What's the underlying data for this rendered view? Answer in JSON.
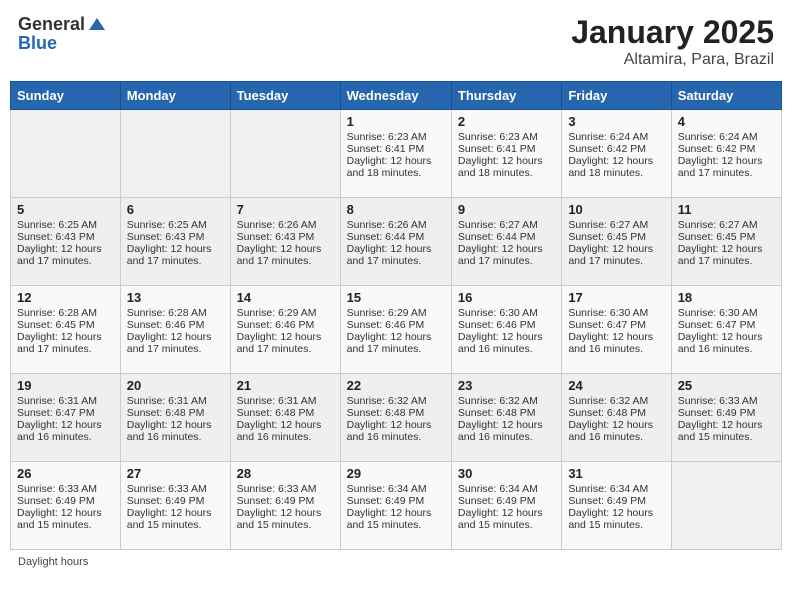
{
  "header": {
    "logo_general": "General",
    "logo_blue": "Blue",
    "title": "January 2025",
    "subtitle": "Altamira, Para, Brazil"
  },
  "days_of_week": [
    "Sunday",
    "Monday",
    "Tuesday",
    "Wednesday",
    "Thursday",
    "Friday",
    "Saturday"
  ],
  "weeks": [
    [
      {
        "day": "",
        "sunrise": "",
        "sunset": "",
        "daylight": "",
        "empty": true
      },
      {
        "day": "",
        "sunrise": "",
        "sunset": "",
        "daylight": "",
        "empty": true
      },
      {
        "day": "",
        "sunrise": "",
        "sunset": "",
        "daylight": "",
        "empty": true
      },
      {
        "day": "1",
        "sunrise": "Sunrise: 6:23 AM",
        "sunset": "Sunset: 6:41 PM",
        "daylight": "Daylight: 12 hours and 18 minutes.",
        "empty": false
      },
      {
        "day": "2",
        "sunrise": "Sunrise: 6:23 AM",
        "sunset": "Sunset: 6:41 PM",
        "daylight": "Daylight: 12 hours and 18 minutes.",
        "empty": false
      },
      {
        "day": "3",
        "sunrise": "Sunrise: 6:24 AM",
        "sunset": "Sunset: 6:42 PM",
        "daylight": "Daylight: 12 hours and 18 minutes.",
        "empty": false
      },
      {
        "day": "4",
        "sunrise": "Sunrise: 6:24 AM",
        "sunset": "Sunset: 6:42 PM",
        "daylight": "Daylight: 12 hours and 17 minutes.",
        "empty": false
      }
    ],
    [
      {
        "day": "5",
        "sunrise": "Sunrise: 6:25 AM",
        "sunset": "Sunset: 6:43 PM",
        "daylight": "Daylight: 12 hours and 17 minutes.",
        "empty": false
      },
      {
        "day": "6",
        "sunrise": "Sunrise: 6:25 AM",
        "sunset": "Sunset: 6:43 PM",
        "daylight": "Daylight: 12 hours and 17 minutes.",
        "empty": false
      },
      {
        "day": "7",
        "sunrise": "Sunrise: 6:26 AM",
        "sunset": "Sunset: 6:43 PM",
        "daylight": "Daylight: 12 hours and 17 minutes.",
        "empty": false
      },
      {
        "day": "8",
        "sunrise": "Sunrise: 6:26 AM",
        "sunset": "Sunset: 6:44 PM",
        "daylight": "Daylight: 12 hours and 17 minutes.",
        "empty": false
      },
      {
        "day": "9",
        "sunrise": "Sunrise: 6:27 AM",
        "sunset": "Sunset: 6:44 PM",
        "daylight": "Daylight: 12 hours and 17 minutes.",
        "empty": false
      },
      {
        "day": "10",
        "sunrise": "Sunrise: 6:27 AM",
        "sunset": "Sunset: 6:45 PM",
        "daylight": "Daylight: 12 hours and 17 minutes.",
        "empty": false
      },
      {
        "day": "11",
        "sunrise": "Sunrise: 6:27 AM",
        "sunset": "Sunset: 6:45 PM",
        "daylight": "Daylight: 12 hours and 17 minutes.",
        "empty": false
      }
    ],
    [
      {
        "day": "12",
        "sunrise": "Sunrise: 6:28 AM",
        "sunset": "Sunset: 6:45 PM",
        "daylight": "Daylight: 12 hours and 17 minutes.",
        "empty": false
      },
      {
        "day": "13",
        "sunrise": "Sunrise: 6:28 AM",
        "sunset": "Sunset: 6:46 PM",
        "daylight": "Daylight: 12 hours and 17 minutes.",
        "empty": false
      },
      {
        "day": "14",
        "sunrise": "Sunrise: 6:29 AM",
        "sunset": "Sunset: 6:46 PM",
        "daylight": "Daylight: 12 hours and 17 minutes.",
        "empty": false
      },
      {
        "day": "15",
        "sunrise": "Sunrise: 6:29 AM",
        "sunset": "Sunset: 6:46 PM",
        "daylight": "Daylight: 12 hours and 17 minutes.",
        "empty": false
      },
      {
        "day": "16",
        "sunrise": "Sunrise: 6:30 AM",
        "sunset": "Sunset: 6:46 PM",
        "daylight": "Daylight: 12 hours and 16 minutes.",
        "empty": false
      },
      {
        "day": "17",
        "sunrise": "Sunrise: 6:30 AM",
        "sunset": "Sunset: 6:47 PM",
        "daylight": "Daylight: 12 hours and 16 minutes.",
        "empty": false
      },
      {
        "day": "18",
        "sunrise": "Sunrise: 6:30 AM",
        "sunset": "Sunset: 6:47 PM",
        "daylight": "Daylight: 12 hours and 16 minutes.",
        "empty": false
      }
    ],
    [
      {
        "day": "19",
        "sunrise": "Sunrise: 6:31 AM",
        "sunset": "Sunset: 6:47 PM",
        "daylight": "Daylight: 12 hours and 16 minutes.",
        "empty": false
      },
      {
        "day": "20",
        "sunrise": "Sunrise: 6:31 AM",
        "sunset": "Sunset: 6:48 PM",
        "daylight": "Daylight: 12 hours and 16 minutes.",
        "empty": false
      },
      {
        "day": "21",
        "sunrise": "Sunrise: 6:31 AM",
        "sunset": "Sunset: 6:48 PM",
        "daylight": "Daylight: 12 hours and 16 minutes.",
        "empty": false
      },
      {
        "day": "22",
        "sunrise": "Sunrise: 6:32 AM",
        "sunset": "Sunset: 6:48 PM",
        "daylight": "Daylight: 12 hours and 16 minutes.",
        "empty": false
      },
      {
        "day": "23",
        "sunrise": "Sunrise: 6:32 AM",
        "sunset": "Sunset: 6:48 PM",
        "daylight": "Daylight: 12 hours and 16 minutes.",
        "empty": false
      },
      {
        "day": "24",
        "sunrise": "Sunrise: 6:32 AM",
        "sunset": "Sunset: 6:48 PM",
        "daylight": "Daylight: 12 hours and 16 minutes.",
        "empty": false
      },
      {
        "day": "25",
        "sunrise": "Sunrise: 6:33 AM",
        "sunset": "Sunset: 6:49 PM",
        "daylight": "Daylight: 12 hours and 15 minutes.",
        "empty": false
      }
    ],
    [
      {
        "day": "26",
        "sunrise": "Sunrise: 6:33 AM",
        "sunset": "Sunset: 6:49 PM",
        "daylight": "Daylight: 12 hours and 15 minutes.",
        "empty": false
      },
      {
        "day": "27",
        "sunrise": "Sunrise: 6:33 AM",
        "sunset": "Sunset: 6:49 PM",
        "daylight": "Daylight: 12 hours and 15 minutes.",
        "empty": false
      },
      {
        "day": "28",
        "sunrise": "Sunrise: 6:33 AM",
        "sunset": "Sunset: 6:49 PM",
        "daylight": "Daylight: 12 hours and 15 minutes.",
        "empty": false
      },
      {
        "day": "29",
        "sunrise": "Sunrise: 6:34 AM",
        "sunset": "Sunset: 6:49 PM",
        "daylight": "Daylight: 12 hours and 15 minutes.",
        "empty": false
      },
      {
        "day": "30",
        "sunrise": "Sunrise: 6:34 AM",
        "sunset": "Sunset: 6:49 PM",
        "daylight": "Daylight: 12 hours and 15 minutes.",
        "empty": false
      },
      {
        "day": "31",
        "sunrise": "Sunrise: 6:34 AM",
        "sunset": "Sunset: 6:49 PM",
        "daylight": "Daylight: 12 hours and 15 minutes.",
        "empty": false
      },
      {
        "day": "",
        "sunrise": "",
        "sunset": "",
        "daylight": "",
        "empty": true
      }
    ]
  ],
  "footer": {
    "daylight_label": "Daylight hours"
  }
}
